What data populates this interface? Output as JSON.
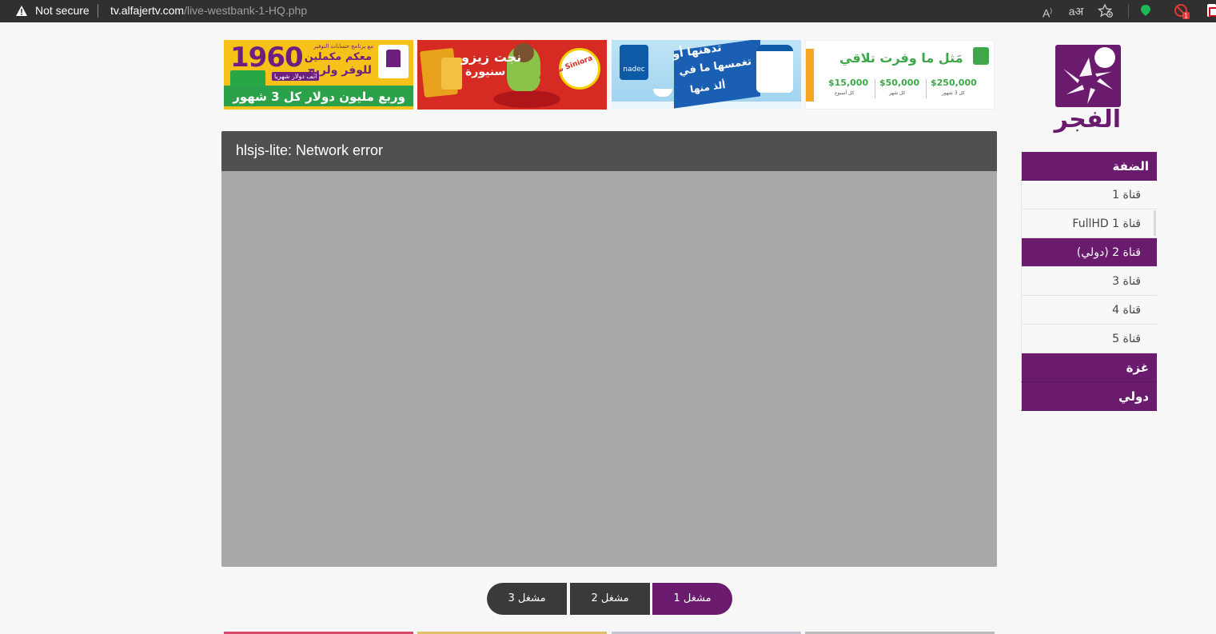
{
  "browser": {
    "security_label": "Not secure",
    "url_host": "tv.alfajertv.com",
    "url_path": "/live-westbank-1-HQ.php",
    "toolbar_icons": [
      "read-aloud-icon",
      "translate-icon",
      "favorite-icon",
      "extension-green-icon",
      "extension-red-icon",
      "extension-icon"
    ],
    "extension_badge": "1"
  },
  "ads": [
    {
      "line_small": "مع برنامج حسابات التوفير",
      "line_a": "معكم مكملين",
      "line_b": "للوفر ولربح",
      "number": "1960",
      "number_sub": "ألف دولار شهريا",
      "strip": "وربع مليون دولار كل 3 شهور"
    },
    {
      "line_a": "نجت زيزو",
      "line_b": "سنيورة",
      "brand": "سنيورة Siniora"
    },
    {
      "brand": "nadec",
      "line_a": "تدهنها أو",
      "line_b": "تغمسها ما في",
      "line_c": "ألذ منها"
    },
    {
      "title": "مَثل ما وفرت تلاقي",
      "prices": [
        "$15,000",
        "$50,000",
        "$250,000"
      ],
      "periods": [
        "كل أسبوع",
        "كل شهر",
        "كل 3 شهور"
      ]
    }
  ],
  "player": {
    "error_text": "hlsjs-lite: Network error"
  },
  "player_buttons": [
    {
      "label": "مشغل 3"
    },
    {
      "label": "مشغل 2"
    },
    {
      "label": "مشغل 1",
      "active": true
    }
  ],
  "sidebar": {
    "logo_text": "الفجر",
    "menu": [
      {
        "label": "الضفة",
        "type": "header"
      },
      {
        "label": "قناة 1"
      },
      {
        "label": "قناة 1 FullHD"
      },
      {
        "label": "قناة 2 (دولي)",
        "active": true
      },
      {
        "label": "قناة 3"
      },
      {
        "label": "قناة 4"
      },
      {
        "label": "قناة 5"
      },
      {
        "label": "غزة",
        "type": "header"
      },
      {
        "label": "دولي",
        "type": "header"
      }
    ]
  },
  "colors": {
    "brand_purple": "#6a1b6e",
    "player_bg": "#a8a8a8",
    "player_bar": "#505050",
    "button_dark": "#3a3a3a"
  }
}
